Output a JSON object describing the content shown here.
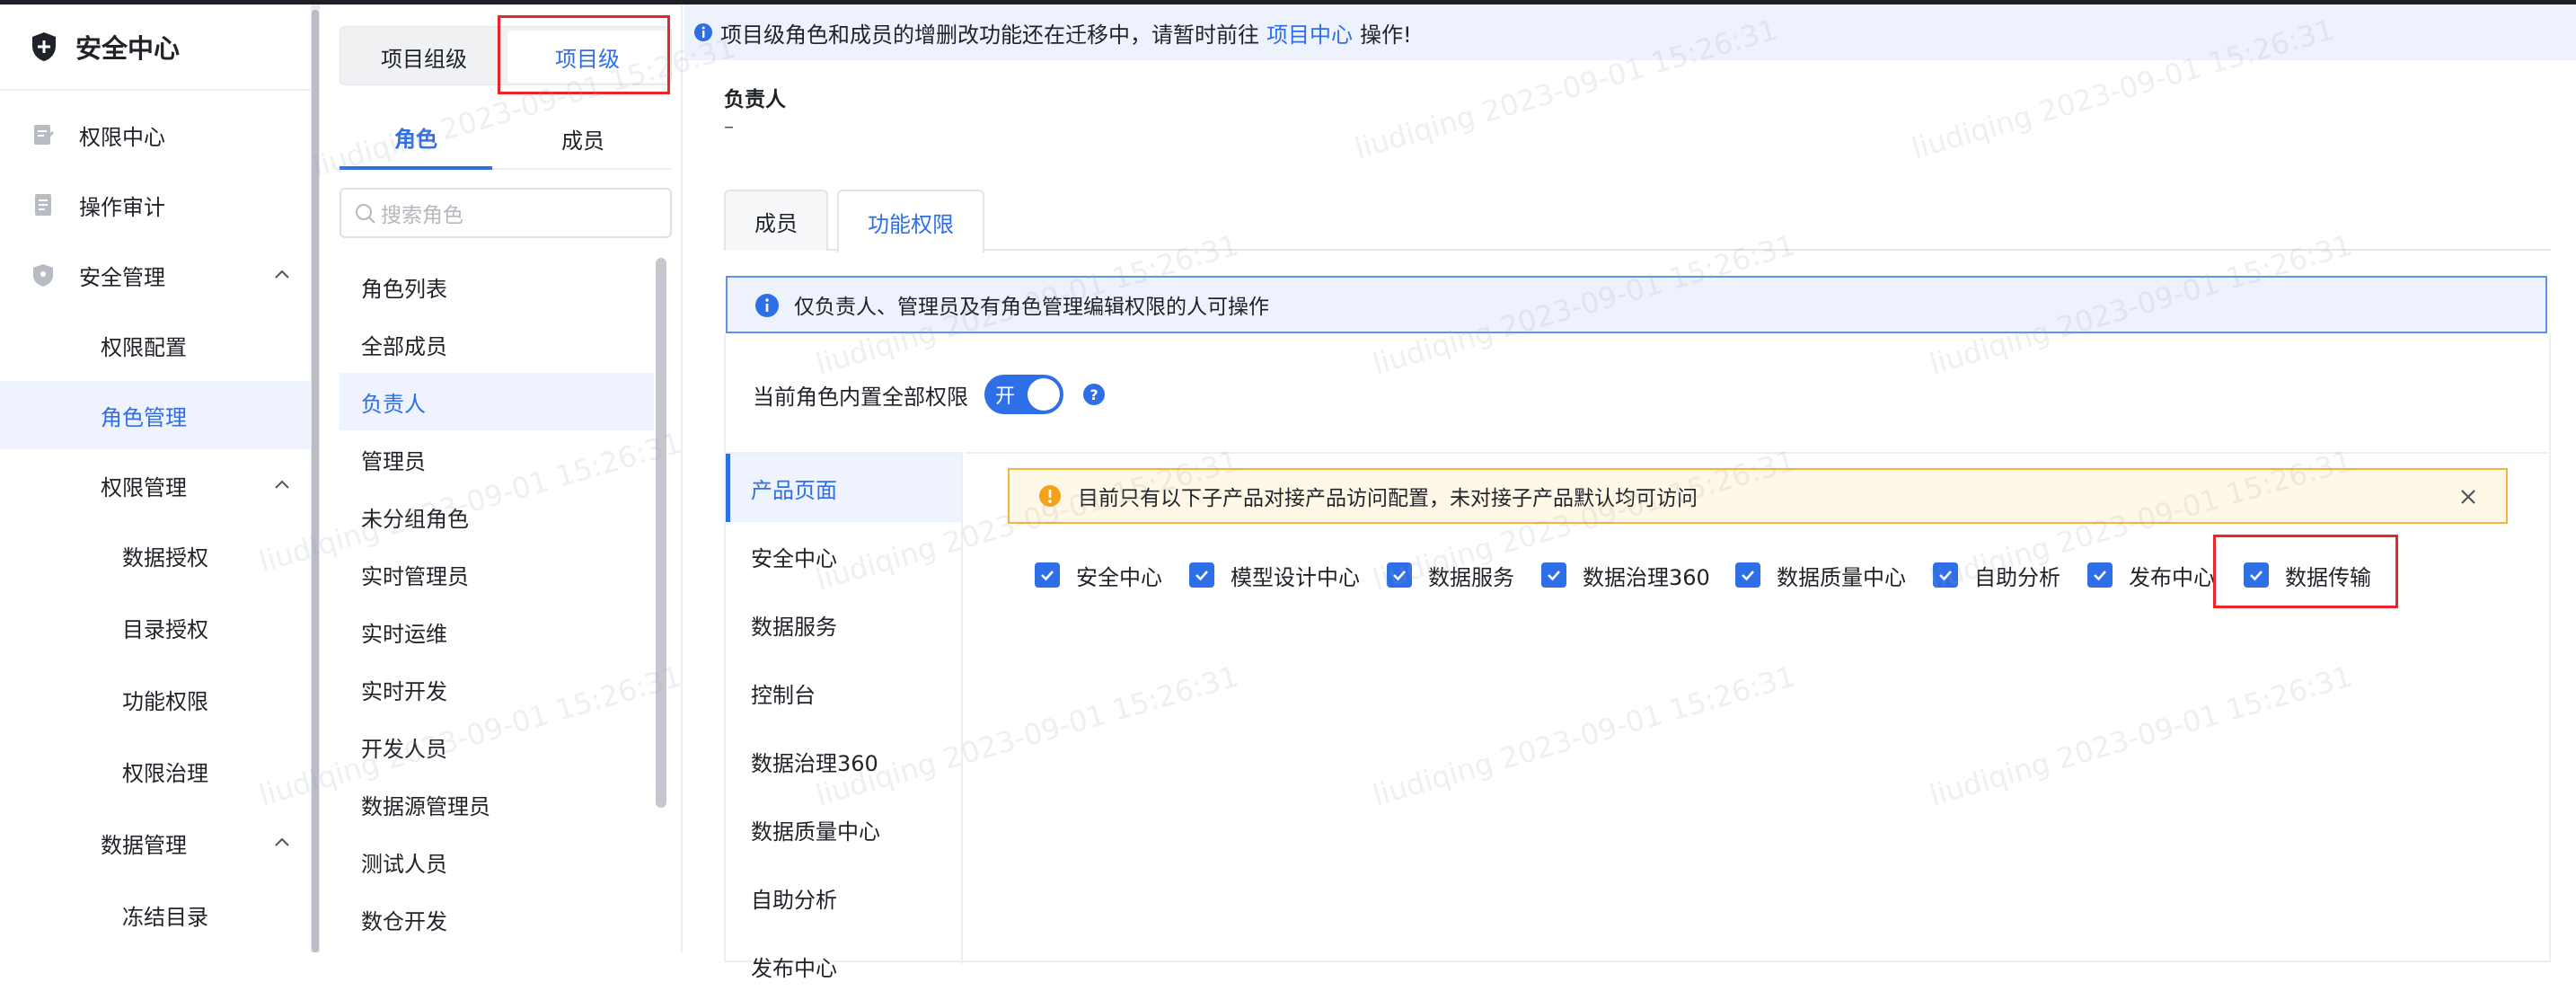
{
  "nav": {
    "title": "安全中心",
    "items": [
      {
        "label": "权限中心",
        "icon": "permission-doc-icon"
      },
      {
        "label": "操作审计",
        "icon": "audit-doc-icon"
      },
      {
        "label": "安全管理",
        "icon": "shield-icon",
        "expanded": true
      },
      {
        "label": "权限配置"
      },
      {
        "label": "角色管理",
        "active": true
      },
      {
        "label": "权限管理",
        "expanded": true
      },
      {
        "label": "数据授权"
      },
      {
        "label": "目录授权"
      },
      {
        "label": "功能权限"
      },
      {
        "label": "权限治理"
      },
      {
        "label": "数据管理",
        "expanded": true
      },
      {
        "label": "冻结目录"
      }
    ]
  },
  "role_panel": {
    "seg": {
      "group_label": "项目组级",
      "project_label": "项目级",
      "selected": "项目级"
    },
    "tabs": {
      "role_label": "角色",
      "member_label": "成员",
      "selected": "角色"
    },
    "search_placeholder": "搜索角色",
    "roles": [
      "角色列表",
      "全部成员",
      "负责人",
      "管理员",
      "未分组角色",
      "实时管理员",
      "实时运维",
      "实时开发",
      "开发人员",
      "数据源管理员",
      "测试人员",
      "数仓开发"
    ],
    "selected_role": "负责人"
  },
  "main": {
    "banner": {
      "text": "项目级角色和成员的增删改功能还在迁移中，请暂时前往",
      "link": "项目中心",
      "suffix": "操作!"
    },
    "owner_label": "负责人",
    "owner_value": "–",
    "tabs": {
      "member_label": "成员",
      "perm_label": "功能权限",
      "selected": "功能权限"
    },
    "info_text": "仅负责人、管理员及有角色管理编辑权限的人可操作",
    "toggle_label": "当前角色内置全部权限",
    "toggle_on_text": "开",
    "help_symbol": "?",
    "vtabs": [
      "产品页面",
      "安全中心",
      "数据服务",
      "控制台",
      "数据治理360",
      "数据质量中心",
      "自助分析",
      "发布中心"
    ],
    "selected_vtab": "产品页面",
    "warning_text": "目前只有以下子产品对接产品访问配置，未对接子产品默认均可访问",
    "checkboxes": [
      "安全中心",
      "模型设计中心",
      "数据服务",
      "数据治理360",
      "数据质量中心",
      "自助分析",
      "发布中心",
      "数据传输"
    ]
  },
  "watermark": "liudiqing 2023-09-01 15:26:31",
  "colors": {
    "accent": "#2e6ee7",
    "highlight_red": "#e8262a",
    "warning": "#f3b53d"
  }
}
